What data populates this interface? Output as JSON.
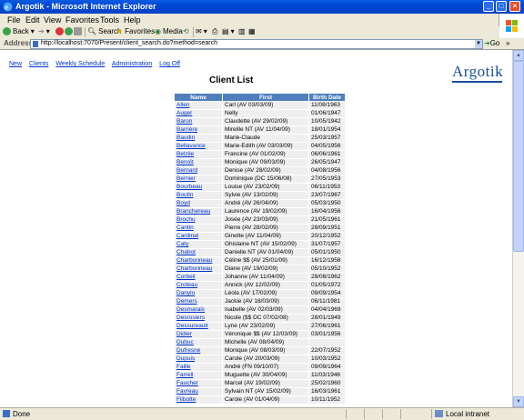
{
  "window": {
    "title": "Argotik - Microsoft Internet Explorer"
  },
  "menu": [
    "File",
    "Edit",
    "View",
    "Favorites",
    "Tools",
    "Help"
  ],
  "toolbar": {
    "back": "Back",
    "search": "Search",
    "favorites": "Favorites",
    "media": "Media"
  },
  "address": {
    "label": "Address",
    "url": "http://localhost:7070/Present/client_search.do?method=search",
    "go": "Go",
    "links": "»"
  },
  "nav": [
    "New",
    "Clients",
    "Weekly Schedule",
    "Administration",
    "Log Off"
  ],
  "logo": "Argotik",
  "page_title": "Client List",
  "table": {
    "headers": [
      "Name",
      "First",
      "Birth Date"
    ],
    "rows": [
      [
        "Allen",
        "Carl (AV 03/03/09)",
        "11/08/1963"
      ],
      [
        "Auger",
        "Nelly",
        "01/06/1947"
      ],
      [
        "Baron",
        "Claudette (AV 29/02/09)",
        "10/05/1942"
      ],
      [
        "Barrière",
        "Mireille NT (AV 11/04/09)",
        "18/01/1954"
      ],
      [
        "Baudin",
        "Marie-Claude",
        "25/03/1957"
      ],
      [
        "Bellavance",
        "Marie-Edith (AV 03/03/09)",
        "04/05/1956"
      ],
      [
        "Belzile",
        "Francine (AV 01/02/09)",
        "06/06/1961"
      ],
      [
        "Benoît",
        "Monique (AV 09/03/09)",
        "26/05/1947"
      ],
      [
        "Bernard",
        "Denise (AV 28/02/09)",
        "04/08/1956"
      ],
      [
        "Bernier",
        "Dominique (DC 15/06/08)",
        "27/05/1953"
      ],
      [
        "Bourbeau",
        "Louise (AV 23/02/09)",
        "06/11/1953"
      ],
      [
        "Boutin",
        "Sylvie (AV 13/02/09)",
        "23/07/1967"
      ],
      [
        "Boyd",
        "André (AV 26/04/09)",
        "05/03/1950"
      ],
      [
        "Branchereau",
        "Laurence (AV 19/02/09)",
        "16/04/1956"
      ],
      [
        "Brochu",
        "Josée (AV 23/03/09)",
        "21/05/1961"
      ],
      [
        "Cantin",
        "Pierre (AV 28/02/09)",
        "28/09/1951"
      ],
      [
        "Cardinal",
        "Ginette (AV 11/04/09)",
        "20/12/1952"
      ],
      [
        "Caty",
        "Ghislaine NT (AV 15/02/09)",
        "31/07/1957"
      ],
      [
        "Chabot",
        "Danielle NT (AV 01/04/09)",
        "05/01/1950"
      ],
      [
        "Charbonneau",
        "Céline $$ (AV 25/01/09)",
        "16/12/1958"
      ],
      [
        "Charbonneau",
        "Diane (AV 19/02/09)",
        "05/10/1952"
      ],
      [
        "Corbeil",
        "Johanne (AV 11/04/09)",
        "28/08/1962"
      ],
      [
        "Croteau",
        "Annick (AV 12/02/09)",
        "01/05/1972"
      ],
      [
        "Danylo",
        "Léola (AV 17/02/09)",
        "09/09/1954"
      ],
      [
        "Demers",
        "Jackie (AV 18/03/09)",
        "06/11/1981"
      ],
      [
        "Desmarais",
        "Isabelle (AV 02/03/09)",
        "04/04/1969"
      ],
      [
        "Desrosiers",
        "Nicole ($$ DC 07/02/08)",
        "28/01/1949"
      ],
      [
        "Dessureault",
        "Lyne (AV 23/02/09)",
        "27/06/1961"
      ],
      [
        "Didier",
        "Véronique $$ (AV 12/03/09)",
        "03/01/1956"
      ],
      [
        "Dubuc",
        "Michelle (AV 08/04/09)",
        ""
      ],
      [
        "Dufresne",
        "Monique (AV 08/03/09)",
        "22/07/1952"
      ],
      [
        "Dupuis",
        "Carole (AV 20/03/09)",
        "10/03/1952"
      ],
      [
        "Faille",
        "André (FN 09/10/07)",
        "09/09/1964"
      ],
      [
        "Farrell",
        "Muguette (AV 30/04/09)",
        "11/03/1946"
      ],
      [
        "Faucher",
        "Marcel (AV 19/02/09)",
        "25/02/1960"
      ],
      [
        "Favreau",
        "Sylvain NT (AV 15/02/09)",
        "16/03/1961"
      ],
      [
        "Flibotte",
        "Carole (AV 01/04/09)",
        "10/11/1952"
      ]
    ]
  },
  "status": {
    "left": "Done",
    "zone": "Local intranet"
  }
}
